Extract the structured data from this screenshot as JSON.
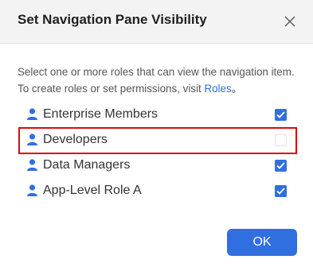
{
  "dialog": {
    "title": "Set Navigation Pane Visibility",
    "description": "Select one or more roles that can view the navigation item. To create roles or set permissions, visit ",
    "description_link": "Roles",
    "description_end": "。",
    "ok_label": "OK"
  },
  "roles": [
    {
      "label": "Enterprise Members",
      "checked": true
    },
    {
      "label": "Developers",
      "checked": false
    },
    {
      "label": "Data Managers",
      "checked": true
    },
    {
      "label": "App-Level Role A",
      "checked": true
    }
  ],
  "colors": {
    "accent": "#2f6fe0",
    "highlight": "#d90b0b"
  },
  "icons": {
    "close": "close-icon",
    "role": "person-icon",
    "check": "check-icon"
  }
}
